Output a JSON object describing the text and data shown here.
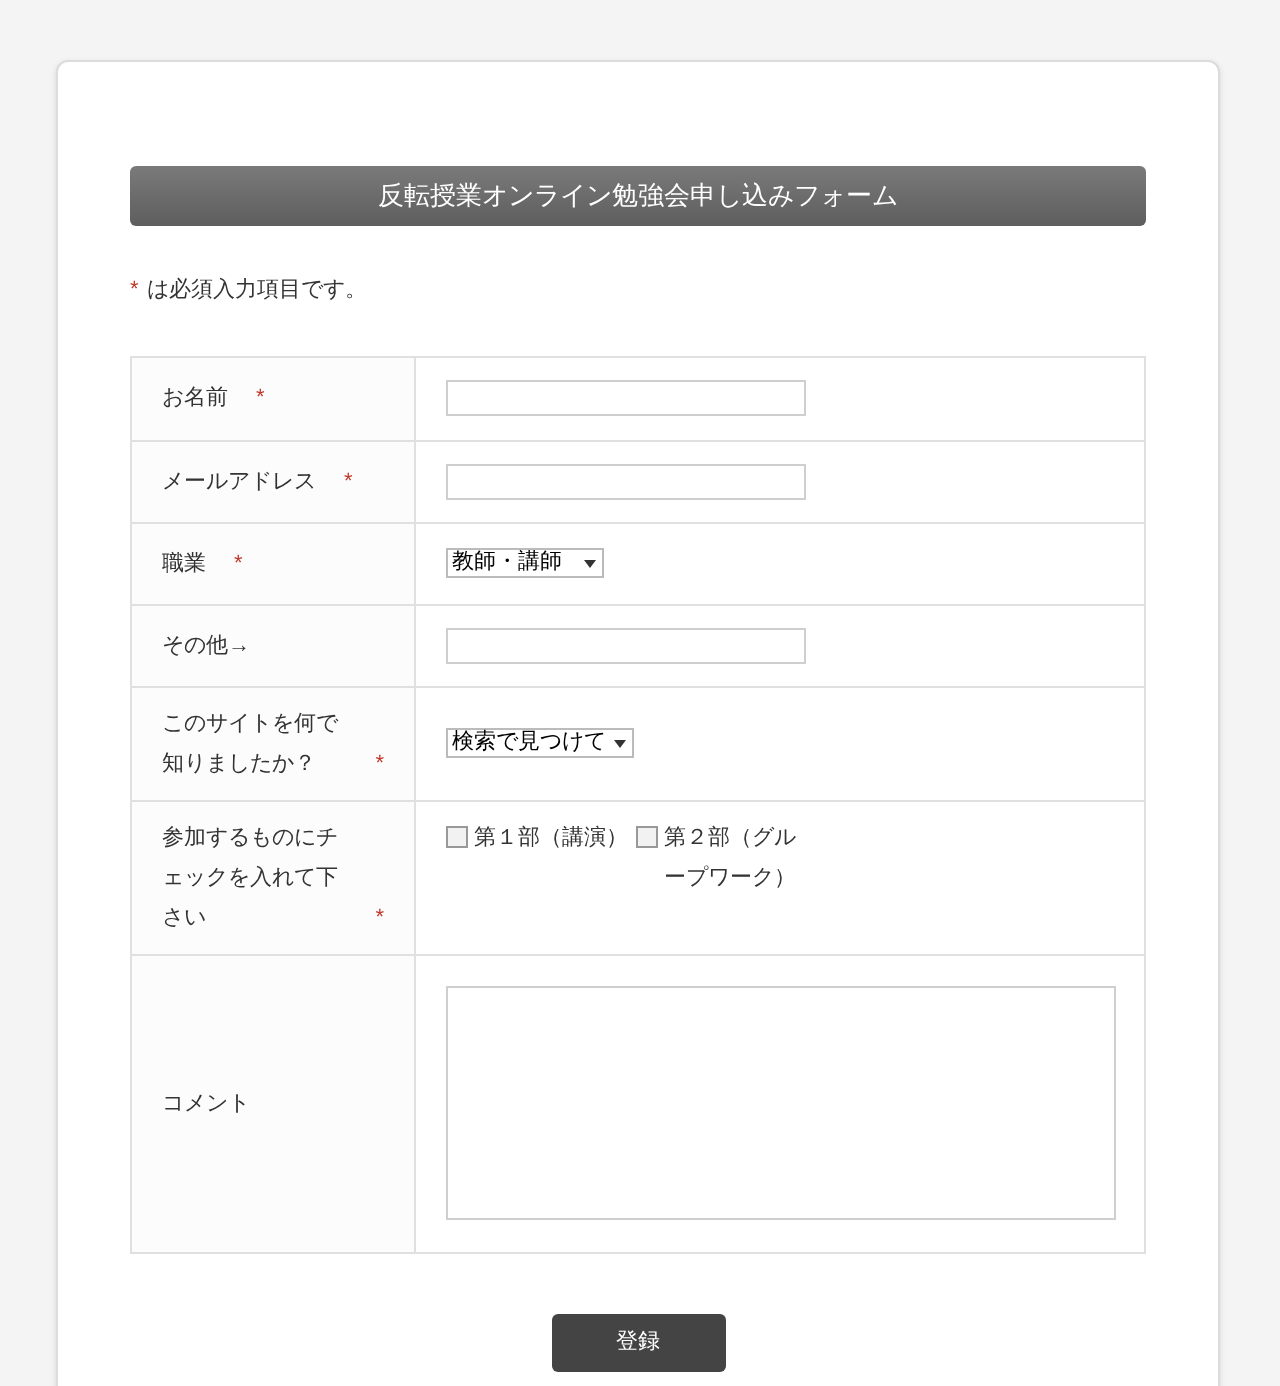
{
  "title": "反転授業オンライン勉強会申し込みフォーム",
  "note": {
    "mark": "*",
    "text": "は必須入力項目です。"
  },
  "fields": [
    {
      "label": "お名前",
      "mark": "*",
      "kind": "text"
    },
    {
      "label": "メールアドレス",
      "mark": "*",
      "kind": "text"
    },
    {
      "label": "職業",
      "mark": "*",
      "kind": "select",
      "value": "教師・講師"
    },
    {
      "label": "その他→",
      "kind": "text"
    },
    {
      "label": "このサイトを何で知りましたか？",
      "mark": "*",
      "kind": "select",
      "value": "検索で見つけて"
    },
    {
      "label": "参加するものにチェックを入れて下さい",
      "mark": "*",
      "kind": "checkboxes",
      "options": [
        {
          "label": "第１部（講演）",
          "checked": false
        },
        {
          "label": "第２部（グループワーク）",
          "checked": false
        }
      ]
    },
    {
      "label": "コメント",
      "kind": "textarea"
    }
  ],
  "submit": "登録"
}
